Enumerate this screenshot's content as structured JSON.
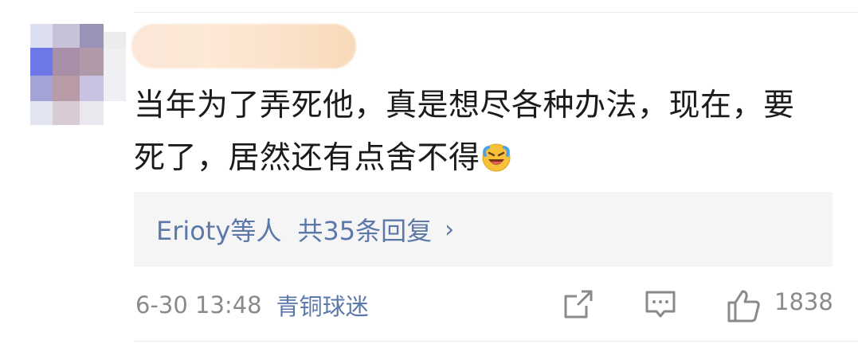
{
  "comment": {
    "line1": "当年为了弄死他，真是想尽各种办法，现在，要",
    "line2": "死了，居然还有点舍不得"
  },
  "reply": {
    "users": "Erioty等人",
    "count": "共35条回复",
    "chevron": "›"
  },
  "meta": {
    "time": "6-30 13:48",
    "source": "青铜球迷"
  },
  "actions": {
    "share_icon": "share-icon",
    "comment_icon": "comment-icon",
    "like_icon": "thumbs-up-icon",
    "like_count": "1838"
  },
  "colors": {
    "link": "#5b78a8",
    "meta": "#8a8a8a",
    "text": "#1b1b1b",
    "reply_bg": "#f5f5f5"
  }
}
